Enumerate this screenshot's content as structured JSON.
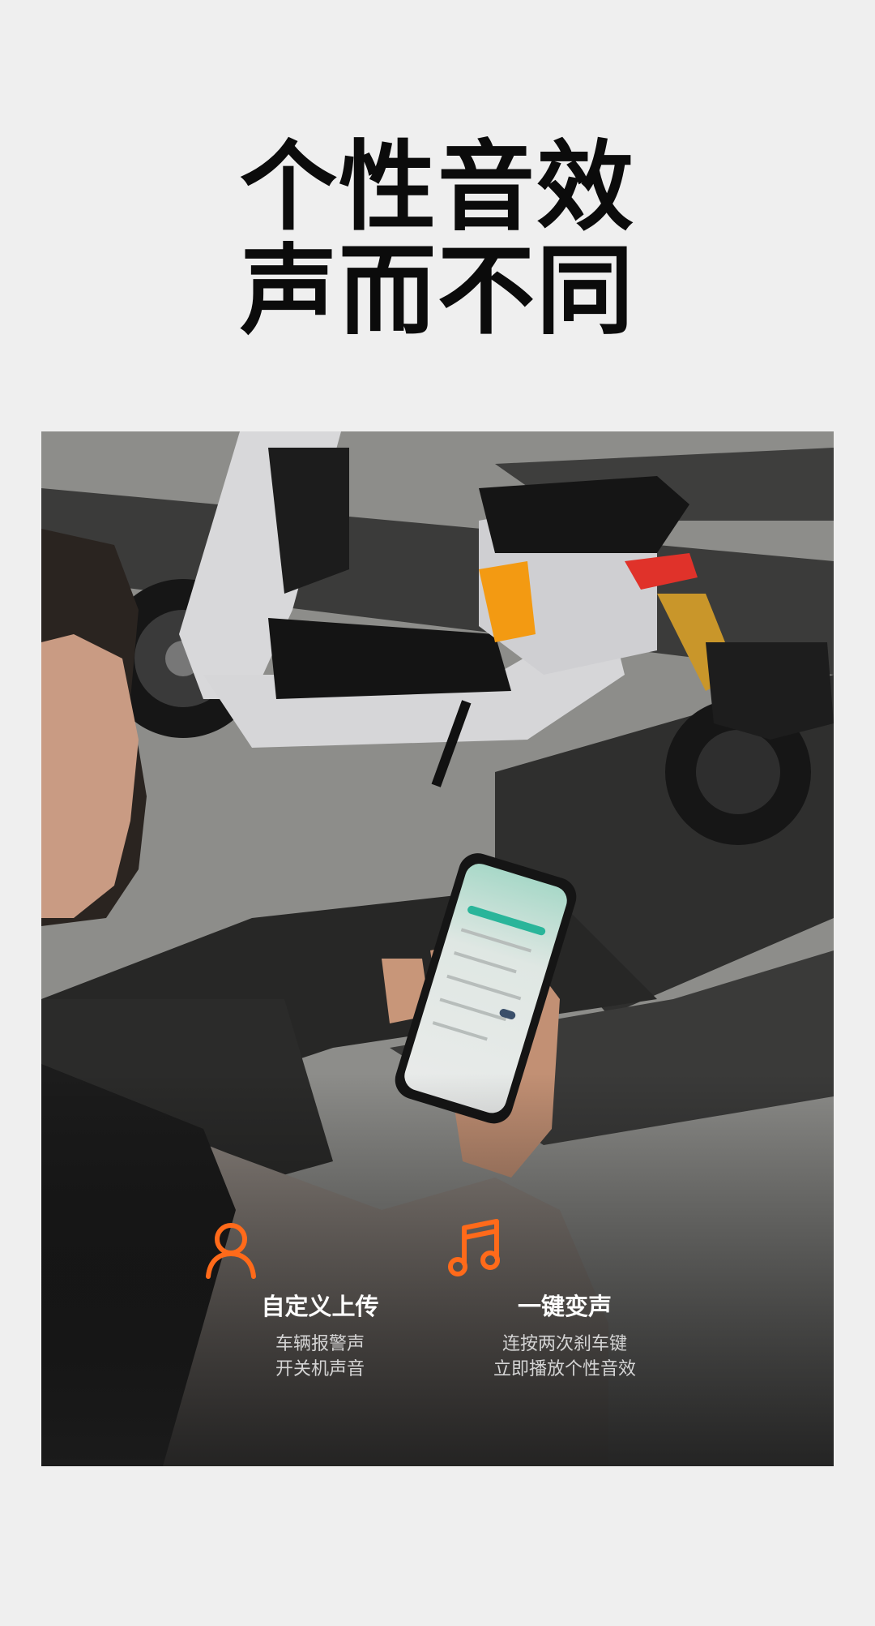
{
  "headline": {
    "line1": "个性音效",
    "line2": "声而不同"
  },
  "features": [
    {
      "icon": "person-icon",
      "title": "自定义上传",
      "desc_line1": "车辆报警声",
      "desc_line2": "开关机声音"
    },
    {
      "icon": "music-note-icon",
      "title": "一键变声",
      "desc_line1": "连按两次刹车键",
      "desc_line2": "立即播放个性音效"
    }
  ],
  "colors": {
    "background": "#efefef",
    "accent": "#ff6a1a",
    "scooter_accent": "#f39a12"
  }
}
